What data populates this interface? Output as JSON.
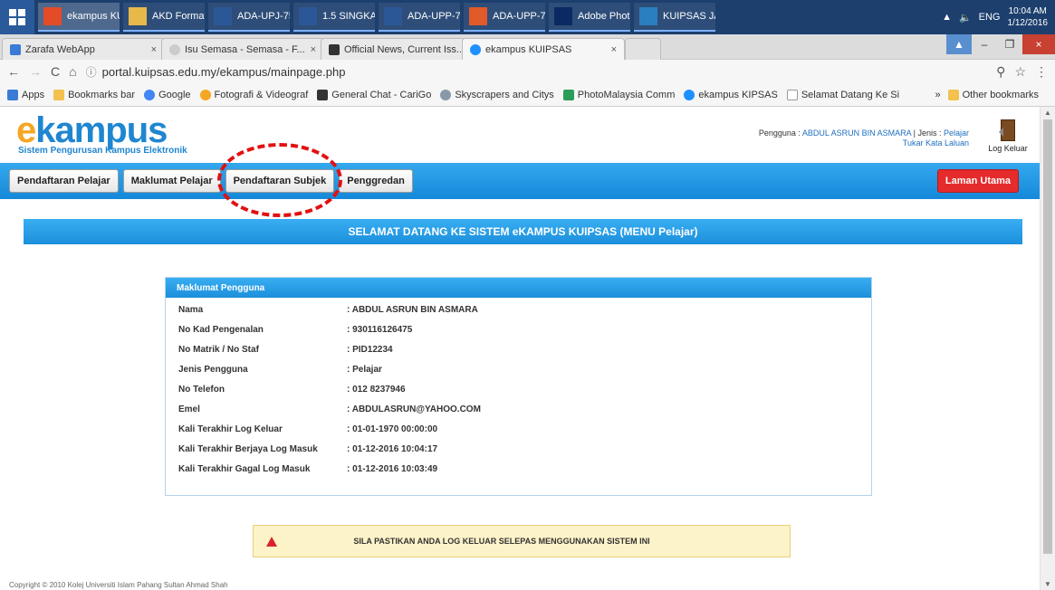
{
  "taskbar": {
    "items": [
      {
        "label": "ekampus KUI...",
        "icon": "chrome-icon",
        "color": "#e34c26"
      },
      {
        "label": "AKD Format ...",
        "icon": "folder-icon",
        "color": "#e7b84a"
      },
      {
        "label": "ADA-UPJ-75...",
        "icon": "word-icon",
        "color": "#2b5797"
      },
      {
        "label": "1.5 SINGKAT...",
        "icon": "word-icon",
        "color": "#2b5797"
      },
      {
        "label": "ADA-UPP-75...",
        "icon": "word-icon",
        "color": "#2b5797"
      },
      {
        "label": "ADA-UPP-75...",
        "icon": "acrobat-icon",
        "color": "#e05a2a"
      },
      {
        "label": "Adobe Phot...",
        "icon": "photoshop-icon",
        "color": "#0b2a63"
      },
      {
        "label": "KUIPSAS JA...",
        "icon": "image-icon",
        "color": "#2a7fc0"
      }
    ],
    "tray_lang": "ENG",
    "time": "10:04 AM",
    "date": "1/12/2016"
  },
  "browser": {
    "tabs": [
      {
        "label": "Zarafa WebApp"
      },
      {
        "label": "Isu Semasa - Semasa - F..."
      },
      {
        "label": "Official News, Current Iss..."
      },
      {
        "label": "ekampus KUIPSAS"
      }
    ],
    "url": "portal.kuipsas.edu.my/ekampus/mainpage.php",
    "bookmarks": [
      "Apps",
      "Bookmarks bar",
      "Google",
      "Fotografi & Videograf",
      "General Chat - CariGo",
      "Skyscrapers and Citys",
      "PhotoMalaysia Comm",
      "ekampus KIPSAS",
      "Selamat Datang Ke Si"
    ],
    "other_bookmarks": "Other bookmarks"
  },
  "header": {
    "logo_e": "e",
    "logo_rest": "kampus",
    "subtitle": "Sistem Pengurusan Kampus Elektronik",
    "user_prefix": "Pengguna : ",
    "user_name": "ABDUL ASRUN BIN ASMARA",
    "type_prefix": " | Jenis : ",
    "user_type": "Pelajar",
    "change_password": "Tukar Kata Laluan",
    "logout": "Log Keluar"
  },
  "nav": {
    "items": [
      "Pendaftaran Pelajar",
      "Maklumat Pelajar",
      "Pendaftaran Subjek",
      "Penggredan"
    ],
    "home": "Laman Utama"
  },
  "welcome": "SELAMAT DATANG KE SISTEM eKAMPUS KUIPSAS (MENU Pelajar)",
  "info": {
    "title": "Maklumat Pengguna",
    "rows": [
      {
        "label": "Nama",
        "value": ": ABDUL ASRUN BIN ASMARA"
      },
      {
        "label": "No Kad Pengenalan",
        "value": ": 930116126475"
      },
      {
        "label": "No Matrik / No Staf",
        "value": ": PID12234"
      },
      {
        "label": "Jenis Pengguna",
        "value": ": Pelajar"
      },
      {
        "label": "No Telefon",
        "value": ": 012 8237946"
      },
      {
        "label": "Emel",
        "value": ": ABDULASRUN@YAHOO.COM"
      },
      {
        "label": "Kali Terakhir Log Keluar",
        "value": ": 01-01-1970 00:00:00"
      },
      {
        "label": "Kali Terakhir Berjaya Log Masuk",
        "value": ": 01-12-2016 10:04:17"
      },
      {
        "label": "Kali Terakhir Gagal Log Masuk",
        "value": ": 01-12-2016 10:03:49"
      }
    ]
  },
  "warning": "SILA PASTIKAN ANDA LOG KELUAR SELEPAS MENGGUNAKAN SISTEM INI",
  "footer": "Copyright © 2010 Kolej Universiti Islam Pahang Sultan Ahmad Shah"
}
